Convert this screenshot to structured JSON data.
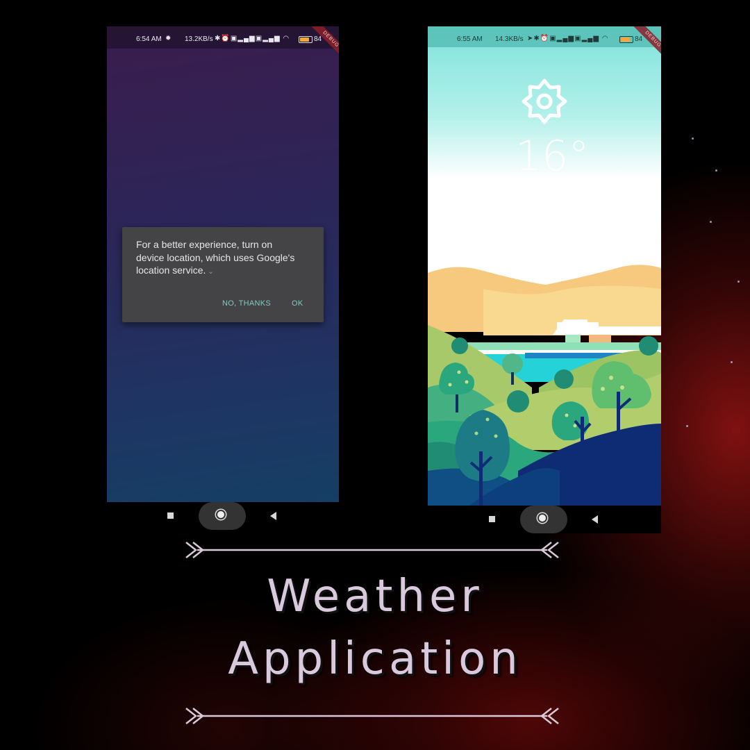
{
  "poster": {
    "title_line1": "Weather",
    "title_line2": "Application"
  },
  "phone_left": {
    "status": {
      "time": "6:54 AM",
      "network_speed": "13.2KB/s",
      "battery": "84",
      "debug": "DEBUG"
    },
    "dialog": {
      "message": "For a better experience, turn on device location, which uses Google's location service.",
      "no_button": "NO, THANKS",
      "ok_button": "OK"
    }
  },
  "phone_right": {
    "status": {
      "time": "6:55 AM",
      "network_speed": "14.3KB/s",
      "battery": "84",
      "debug": "DEBUG"
    },
    "weather": {
      "icon": "sun-icon",
      "temperature": "16°"
    }
  },
  "colors": {
    "dialog_button": "#80cbc4",
    "title_text": "#d9c9dd"
  }
}
